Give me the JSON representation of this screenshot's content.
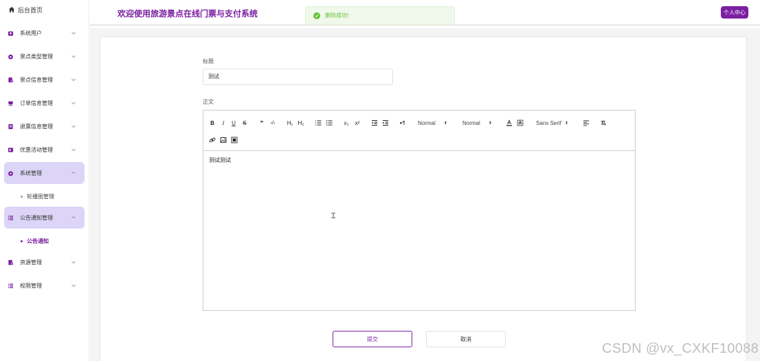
{
  "sidebar": {
    "home_label": "后台首页",
    "items": [
      {
        "label": "系统用户"
      },
      {
        "label": "景点类型管理"
      },
      {
        "label": "景点信息管理"
      },
      {
        "label": "订单信息管理"
      },
      {
        "label": "退票信息管理"
      },
      {
        "label": "优惠活动管理"
      },
      {
        "label": "系统管理"
      },
      {
        "label": "公告通知管理"
      },
      {
        "label": "资源管理"
      },
      {
        "label": "权限管理"
      }
    ],
    "subitems": {
      "carousel": "轮播图管理",
      "notice": "公告通知"
    }
  },
  "header": {
    "title": "欢迎使用旅游景点在线门票与支付系统",
    "toast": "删除成功!",
    "user_center": "个人中心"
  },
  "form": {
    "title_label": "标题",
    "title_value": "测试",
    "body_label": "正文",
    "body_value": "测试测试",
    "submit_label": "提交",
    "cancel_label": "取消"
  },
  "toolbar": {
    "bold": "B",
    "italic": "I",
    "underline": "U",
    "strike": "S",
    "quote": "❞",
    "code": "‹/›",
    "h1": "H₁",
    "h2": "H₂",
    "sub": "x₂",
    "sup": "x²",
    "rtl": "▸¶",
    "size_value": "Normal",
    "header_value": "Normal",
    "font_value": "Sans Serif",
    "clean": "T̸ₓ"
  },
  "watermark": "CSDN @vx_CXKF10088",
  "colors": {
    "accent": "#7b1fa2",
    "active_bg": "#dcd5f7",
    "success": "#67c23a"
  }
}
